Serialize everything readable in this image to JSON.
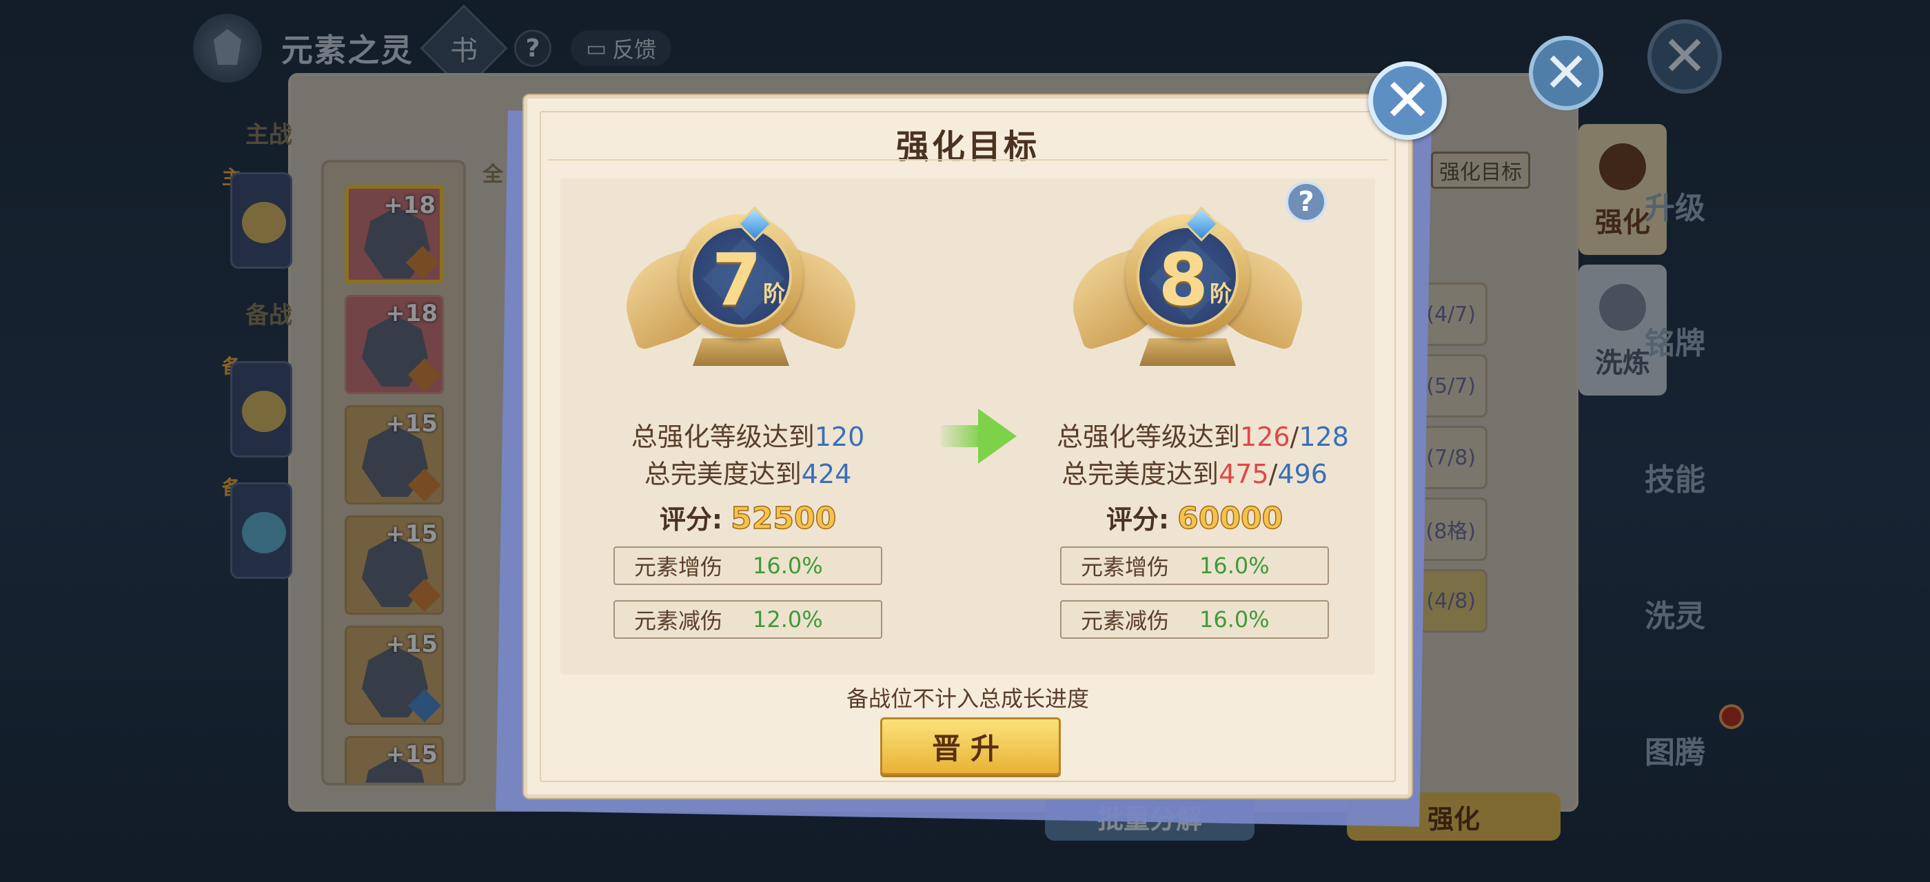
{
  "topbar": {
    "title": "元素之灵",
    "book_glyph": "书",
    "help_glyph": "?",
    "feedback_label": "反馈",
    "feedback_icon": "chat-icon"
  },
  "background": {
    "tab_main": "主战",
    "tab_all": "全",
    "tab_reserve": "备战",
    "slot_main_badge": "主",
    "slot_reserve_badge": "备",
    "target_button": "强化目标",
    "equip_levels": [
      "+18",
      "+18",
      "+15",
      "+15",
      "+15",
      "+15"
    ],
    "right_progress": [
      "(4/7)",
      "(5/7)",
      "(7/8)",
      "(8格)",
      "(4/8)"
    ],
    "side_tabs": {
      "active": "强化",
      "inactive": "洗炼"
    },
    "side_menu": [
      "升级",
      "铭牌",
      "技能",
      "洗灵",
      "图腾"
    ],
    "bottom_left": "批量分解",
    "bottom_right": "强化"
  },
  "modal": {
    "title": "强化目标",
    "close_glyph": "✕",
    "help_glyph": "?",
    "current": {
      "rank_num": "7",
      "rank_suffix": "阶",
      "level_label": "总强化等级达到",
      "level_value": "120",
      "perfect_label": "总完美度达到",
      "perfect_value": "424",
      "score_label": "评分:",
      "score_value": "52500",
      "stats": [
        {
          "name": "元素增伤",
          "value": "16.0%"
        },
        {
          "name": "元素减伤",
          "value": "12.0%"
        }
      ]
    },
    "next": {
      "rank_num": "8",
      "rank_suffix": "阶",
      "level_label": "总强化等级达到",
      "level_current": "126",
      "level_sep": "/",
      "level_target": "128",
      "perfect_label": "总完美度达到",
      "perfect_current": "475",
      "perfect_sep": "/",
      "perfect_target": "496",
      "score_label": "评分:",
      "score_value": "60000",
      "stats": [
        {
          "name": "元素增伤",
          "value": "16.0%"
        },
        {
          "name": "元素减伤",
          "value": "16.0%"
        }
      ]
    },
    "footnote": "备战位不计入总成长进度",
    "promote_button": "晋升"
  },
  "colors": {
    "accent_blue": "#3b6fb6",
    "deficit_red": "#e04747",
    "stat_green": "#3f9a3a",
    "score_gold": "#f7c24a"
  }
}
